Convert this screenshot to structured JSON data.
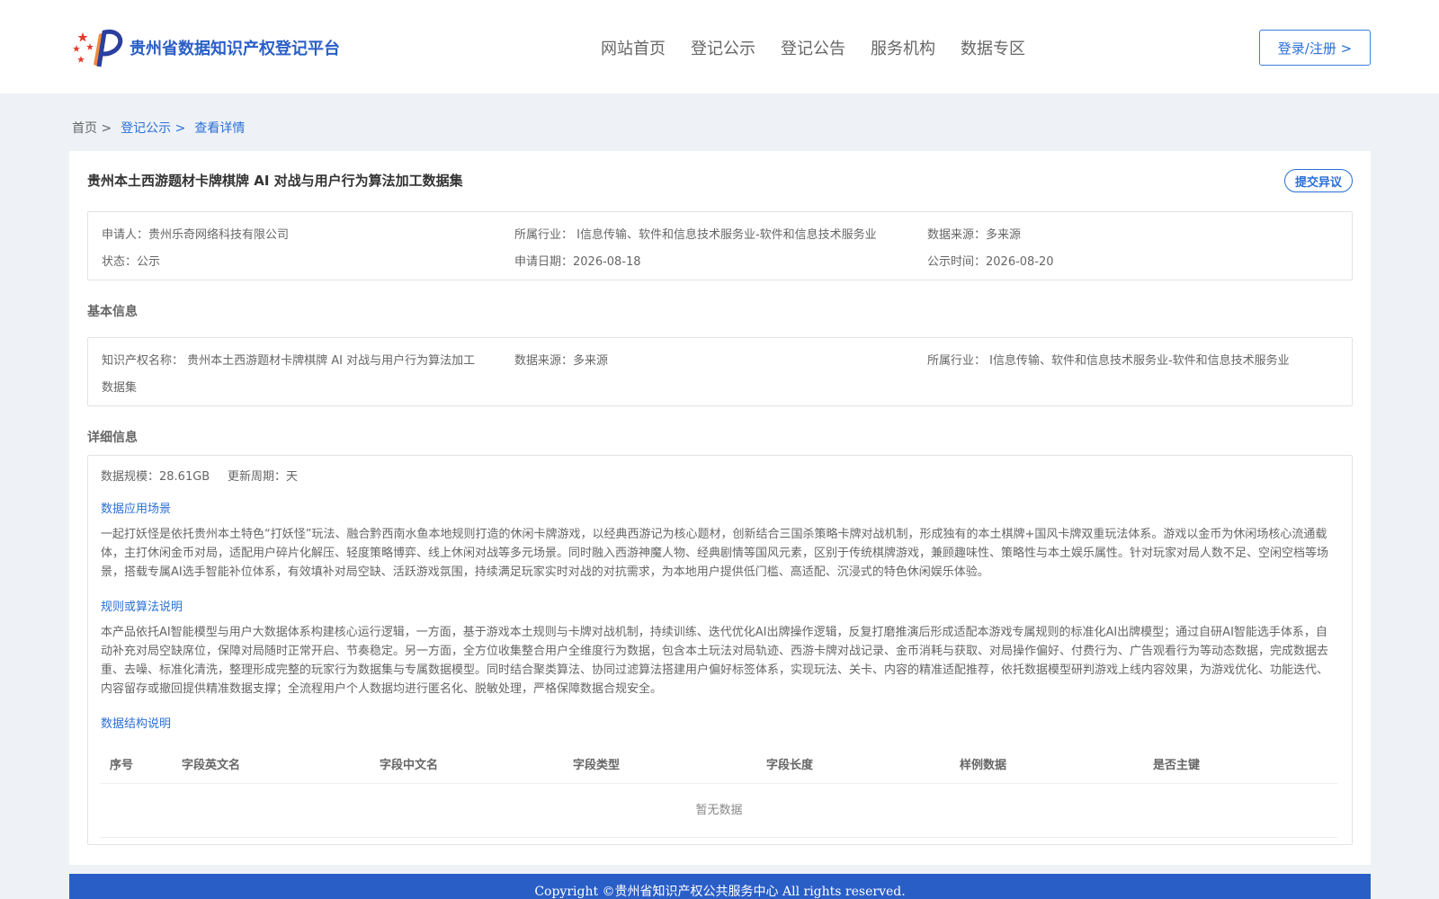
{
  "header": {
    "site_name": "贵州省数据知识产权登记平台",
    "nav": [
      "网站首页",
      "登记公示",
      "登记公告",
      "服务机构",
      "数据专区"
    ],
    "login_label": "登录/注册 >"
  },
  "breadcrumb": {
    "home": "首页 >",
    "parent": "登记公示 >",
    "current": "查看详情"
  },
  "detail": {
    "title": "贵州本土西游题材卡牌棋牌 AI 对战与用户行为算法加工数据集",
    "objection_label": "提交异议",
    "summary": {
      "applicant": "申请人：贵州乐奇网络科技有限公司",
      "industry": "所属行业： I信息传输、软件和信息技术服务业-软件和信息技术服务业",
      "source": "数据来源：多来源",
      "status": "状态：公示",
      "apply_date": "申请日期：2026-08-18",
      "publish_date": "公示时间：2026-08-20"
    },
    "basic": {
      "section_title": "基本信息",
      "name_line1": "知识产权名称： 贵州本土西游题材卡牌棋牌 AI 对战与用户行为算法加工",
      "name_line2": "数据集",
      "source": "数据来源：多来源",
      "industry": "所属行业： I信息传输、软件和信息技术服务业-软件和信息技术服务业"
    },
    "detail_info": {
      "section_title": "详细信息",
      "scale": "数据规模：28.61GB",
      "cycle": "更新周期：天",
      "scenario_title": "数据应用场景",
      "scenario_text": "一起打妖怪是依托贵州本土特色“打妖怪”玩法、融合黔西南水鱼本地规则打造的休闲卡牌游戏，以经典西游记为核心题材，创新结合三国杀策略卡牌对战机制，形成独有的本土棋牌+国风卡牌双重玩法体系。游戏以金币为休闲场核心流通载体，主打休闲金币对局，适配用户碎片化解压、轻度策略博弈、线上休闲对战等多元场景。同时融入西游神魔人物、经典剧情等国风元素，区别于传统棋牌游戏，兼顾趣味性、策略性与本土娱乐属性。针对玩家对局人数不足、空闲空档等场景，搭载专属AI选手智能补位体系，有效填补对局空缺、活跃游戏氛围，持续满足玩家实时对战的对抗需求，为本地用户提供低门槛、高适配、沉浸式的特色休闲娱乐体验。",
      "algorithm_title": "规则或算法说明",
      "algorithm_text": "本产品依托AI智能模型与用户大数据体系构建核心运行逻辑，一方面，基于游戏本土规则与卡牌对战机制，持续训练、迭代优化AI出牌操作逻辑，反复打磨推演后形成适配本游戏专属规则的标准化AI出牌模型；通过自研AI智能选手体系，自动补充对局空缺席位，保障对局随时正常开启、节奏稳定。另一方面，全方位收集整合用户全维度行为数据，包含本土玩法对局轨迹、西游卡牌对战记录、金币消耗与获取、对局操作偏好、付费行为、广告观看行为等动态数据，完成数据去重、去噪、标准化清洗，整理形成完整的玩家行为数据集与专属数据模型。同时结合聚类算法、协同过滤算法搭建用户偏好标签体系，实现玩法、关卡、内容的精准适配推荐，依托数据模型研判游戏上线内容效果，为游戏优化、功能迭代、内容留存或撤回提供精准数据支撑；全流程用户个人数据均进行匿名化、脱敏处理，严格保障数据合规安全。",
      "structure_title": "数据结构说明",
      "table_headers": [
        "序号",
        "字段英文名",
        "字段中文名",
        "字段类型",
        "字段长度",
        "样例数据",
        "是否主键"
      ],
      "empty_text": "暂无数据"
    }
  },
  "footer": {
    "copyright": "Copyright ©贵州省知识产权公共服务中心 All rights reserved."
  }
}
